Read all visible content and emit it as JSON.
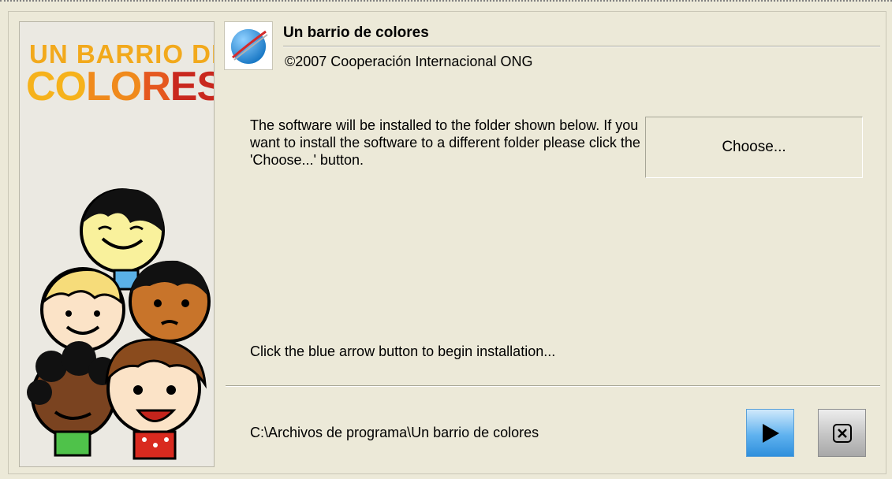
{
  "banner": {
    "line1": "UN BARRIO DE",
    "line2": [
      "CO",
      "LO",
      "R",
      "ES"
    ]
  },
  "header": {
    "title": "Un barrio de colores",
    "copyright": "©2007 Cooperación Internacional ONG"
  },
  "main": {
    "info_text": "The software will be installed to the folder shown below.  If you want to install the software to a different folder please click the 'Choose...' button.",
    "choose_label": "Choose...",
    "hint_text": "Click the blue arrow button to begin installation...",
    "install_path": "C:\\Archivos de programa\\Un barrio de colores"
  },
  "icons": {
    "logo": "globe-logo-icon",
    "install": "play-arrow-icon",
    "cancel": "close-x-icon"
  },
  "colors": {
    "install_button": "#5fb2ef",
    "banner_yellow": "#f6b21b",
    "banner_red": "#c9281e"
  }
}
